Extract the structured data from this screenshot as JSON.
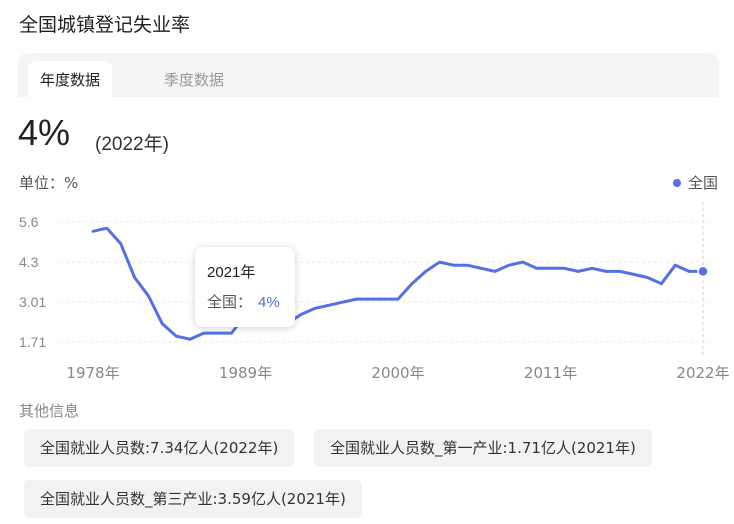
{
  "title": "全国城镇登记失业率",
  "tabs": [
    {
      "label": "年度数据",
      "active": true
    },
    {
      "label": "季度数据",
      "active": false
    }
  ],
  "headline": {
    "value": "4%",
    "year_note": "(2022年)"
  },
  "unit_label": "单位：%",
  "legend": {
    "label": "全国",
    "color": "#5470e6"
  },
  "tooltip": {
    "year": "2021年",
    "label": "全国：",
    "value": "4%"
  },
  "other_info": {
    "title": "其他信息",
    "items": [
      "全国就业人员数:7.34亿人(2022年)",
      "全国就业人员数_第一产业:1.71亿人(2021年)",
      "全国就业人员数_第三产业:3.59亿人(2021年)"
    ]
  },
  "chart_data": {
    "type": "line",
    "series": [
      {
        "name": "全国",
        "color": "#5470e6",
        "x": [
          1978,
          1979,
          1980,
          1981,
          1982,
          1983,
          1984,
          1985,
          1986,
          1987,
          1988,
          1989,
          1990,
          1991,
          1992,
          1993,
          1994,
          1995,
          1996,
          1997,
          1998,
          1999,
          2000,
          2001,
          2002,
          2003,
          2004,
          2005,
          2006,
          2007,
          2008,
          2009,
          2010,
          2011,
          2012,
          2013,
          2014,
          2015,
          2016,
          2017,
          2018,
          2019,
          2020,
          2021,
          2022
        ],
        "values": [
          5.3,
          5.4,
          4.9,
          3.8,
          3.2,
          2.3,
          1.9,
          1.8,
          2.0,
          2.0,
          2.0,
          2.6,
          2.5,
          2.3,
          2.3,
          2.6,
          2.8,
          2.9,
          3.0,
          3.1,
          3.1,
          3.1,
          3.1,
          3.6,
          4.0,
          4.3,
          4.2,
          4.2,
          4.1,
          4.0,
          4.2,
          4.3,
          4.1,
          4.1,
          4.1,
          4.0,
          4.1,
          4.0,
          4.0,
          3.9,
          3.8,
          3.6,
          4.2,
          4.0,
          4.0
        ]
      }
    ],
    "y_ticks": [
      "5.6",
      "4.3",
      "3.01",
      "1.71"
    ],
    "x_ticks": [
      "1978年",
      "1989年",
      "2000年",
      "2011年",
      "2022年"
    ],
    "ylim": [
      1.71,
      5.6
    ],
    "xlim": [
      1978,
      2022
    ],
    "highlight_x": 2022,
    "grid": true,
    "legend_position": "top-right"
  }
}
